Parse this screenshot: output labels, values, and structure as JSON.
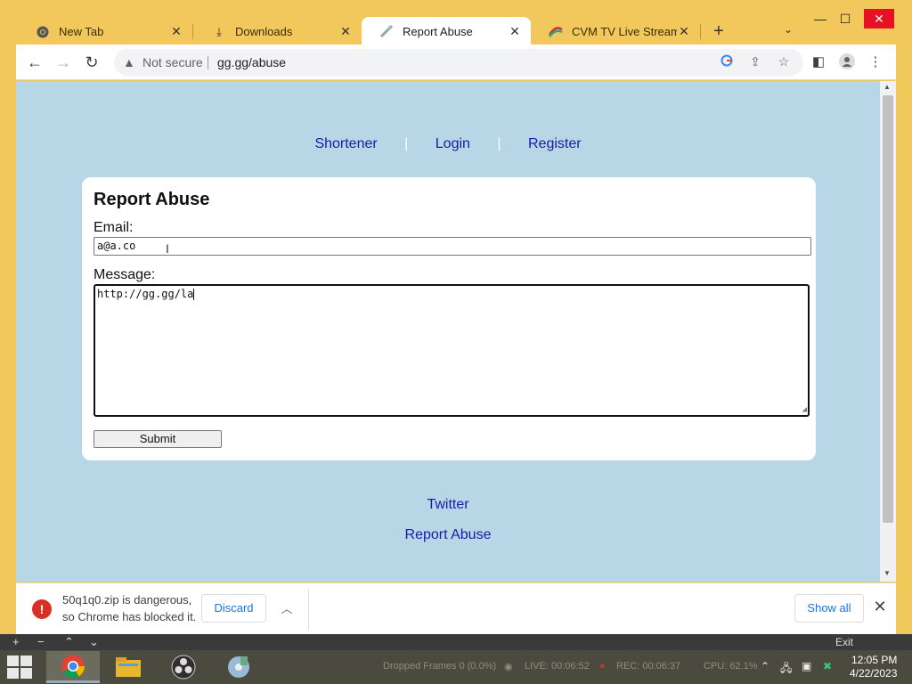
{
  "browser": {
    "tabs": [
      {
        "label": "New Tab",
        "icon": "chrome-icon"
      },
      {
        "label": "Downloads",
        "icon": "download-icon"
      },
      {
        "label": "Report Abuse",
        "icon": "page-favicon",
        "active": true
      },
      {
        "label": "CVM TV Live Stream On",
        "icon": "cvm-favicon"
      }
    ],
    "address": {
      "security_label": "Not secure",
      "url": "gg.gg/abuse"
    }
  },
  "page": {
    "nav": {
      "shortener": "Shortener",
      "login": "Login",
      "register": "Register",
      "separator": "|"
    },
    "form": {
      "title": "Report Abuse",
      "email_label": "Email:",
      "email_value": "a@a.co",
      "message_label": "Message:",
      "message_value": "http://gg.gg/la",
      "submit_label": "Submit"
    },
    "footer": {
      "twitter": "Twitter",
      "report_abuse": "Report Abuse"
    }
  },
  "download_bar": {
    "line1": "50q1q0.zip is dangerous,",
    "line2": "so Chrome has blocked it.",
    "discard_label": "Discard",
    "show_all_label": "Show all"
  },
  "obs": {
    "exit_label": "Exit",
    "dropped_frames": "Dropped Frames 0 (0.0%)",
    "live": "LIVE: 00:06:52",
    "rec": "REC: 00:06:37",
    "cpu": "CPU: 62.1%"
  },
  "taskbar": {
    "time": "12:05 PM",
    "date": "4/22/2023"
  },
  "colors": {
    "page_background": "#b7d7e6",
    "link": "#1a1aa6",
    "chrome_frame": "#f2c75c",
    "danger": "#d93025",
    "chrome_blue": "#1a73e8"
  }
}
